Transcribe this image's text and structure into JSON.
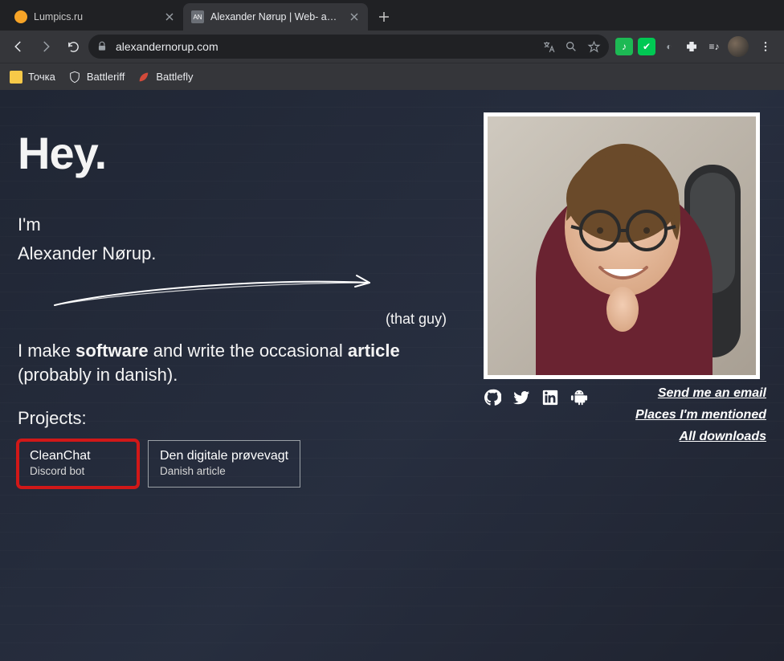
{
  "window": {
    "tabs": [
      {
        "title": "Lumpics.ru",
        "favicon_color": "#f7a427"
      },
      {
        "title": "Alexander Nørup | Web- and sof",
        "favicon_text": "AN",
        "active": true
      }
    ]
  },
  "toolbar": {
    "url": "alexandernorup.com"
  },
  "bookmarks": [
    {
      "label": "Точка",
      "icon": "folder"
    },
    {
      "label": "Battleriff",
      "icon": "shield"
    },
    {
      "label": "Battlefly",
      "icon": "leaf"
    }
  ],
  "page": {
    "hey": "Hey.",
    "intro_line1": "I'm",
    "intro_line2": "Alexander Nørup.",
    "that_guy": "(that guy)",
    "blurb_pre": "I make ",
    "blurb_b1": "software",
    "blurb_mid": " and write the occasional ",
    "blurb_b2": "article",
    "blurb_post": " (probably in danish).",
    "projects_heading": "Projects:",
    "projects": [
      {
        "title": "CleanChat",
        "subtitle": "Discord bot",
        "highlight": true
      },
      {
        "title": "Den digitale prøvevagt",
        "subtitle": "Danish article",
        "highlight": false
      }
    ],
    "links": {
      "email": "Send me an email",
      "places": "Places I'm mentioned",
      "downloads": "All downloads"
    }
  }
}
